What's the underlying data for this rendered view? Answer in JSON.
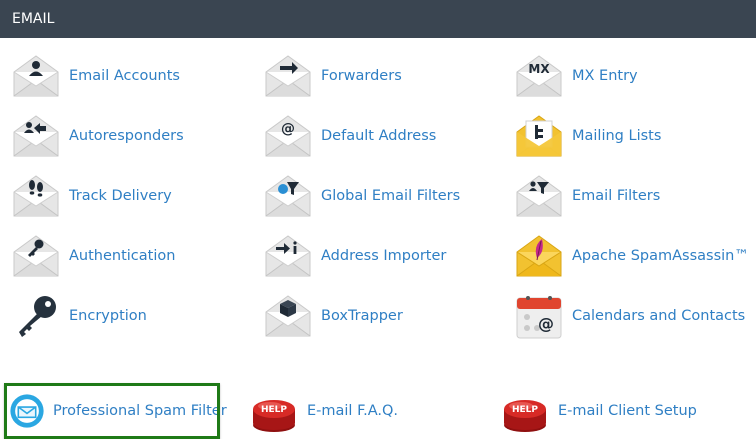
{
  "section": {
    "title": "EMAIL"
  },
  "items": [
    {
      "label": "Email Accounts",
      "icon": "person-envelope-icon"
    },
    {
      "label": "Forwarders",
      "icon": "arrow-envelope-icon"
    },
    {
      "label": "MX Entry",
      "icon": "mx-envelope-icon"
    },
    {
      "label": "Autoresponders",
      "icon": "reply-envelope-icon"
    },
    {
      "label": "Default Address",
      "icon": "at-envelope-icon"
    },
    {
      "label": "Mailing Lists",
      "icon": "list-envelope-icon"
    },
    {
      "label": "Track Delivery",
      "icon": "footprints-envelope-icon"
    },
    {
      "label": "Global Email Filters",
      "icon": "globe-filter-envelope-icon"
    },
    {
      "label": "Email Filters",
      "icon": "filter-envelope-icon"
    },
    {
      "label": "Authentication",
      "icon": "key-envelope-icon"
    },
    {
      "label": "Address Importer",
      "icon": "import-envelope-icon"
    },
    {
      "label": "Apache SpamAssassin™",
      "icon": "feather-envelope-icon"
    },
    {
      "label": "Encryption",
      "icon": "key-icon"
    },
    {
      "label": "BoxTrapper",
      "icon": "box-envelope-icon"
    },
    {
      "label": "Calendars and Contacts",
      "icon": "calendar-icon"
    },
    {
      "label": "Professional Spam Filter",
      "icon": "spam-filter-icon"
    },
    {
      "label": "E-mail F.A.Q.",
      "icon": "help-button-icon"
    },
    {
      "label": "E-mail Client Setup",
      "icon": "help-button-icon"
    }
  ],
  "help_badge_text": "HELP",
  "mx_text": "MX",
  "colors": {
    "header_bg": "#3a4551",
    "link": "#2f7fc4",
    "highlight": "#1f7a17",
    "envelope": "#e9e9e9",
    "glyph": "#1f2a36"
  }
}
